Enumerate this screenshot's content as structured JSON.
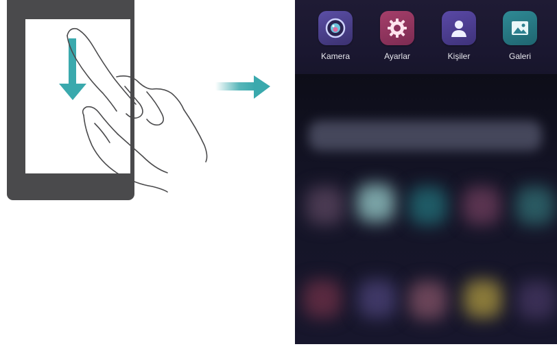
{
  "apps": [
    {
      "label": "Kamera",
      "icon": "camera-icon"
    },
    {
      "label": "Ayarlar",
      "icon": "settings-gear-icon"
    },
    {
      "label": "Kişiler",
      "icon": "contacts-icon"
    },
    {
      "label": "Galeri",
      "icon": "gallery-icon"
    }
  ],
  "colors": {
    "accent_teal": "#3aa9ad",
    "tablet_frame": "#4a4a4c",
    "phone_bg": "#111122"
  }
}
